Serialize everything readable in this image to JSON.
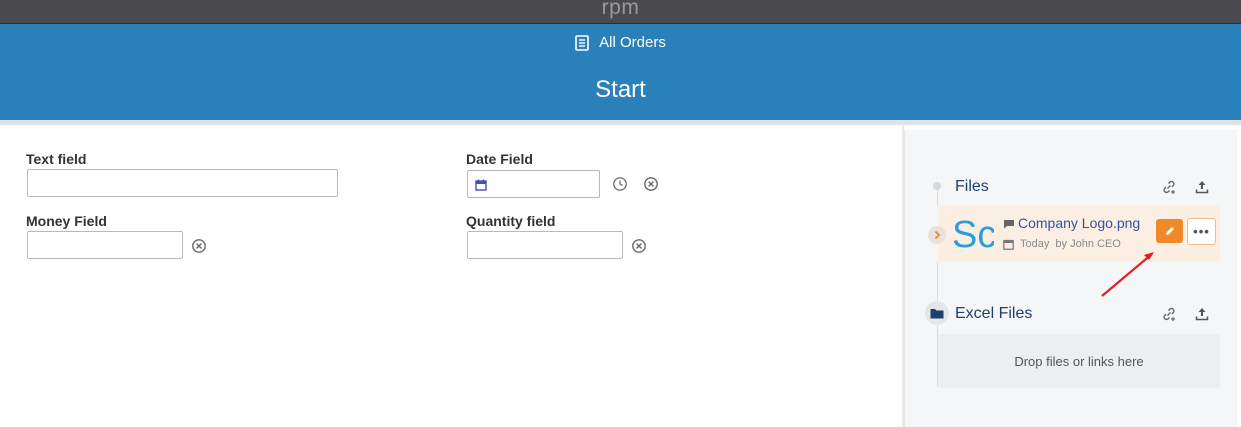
{
  "topbar": {
    "app_name": "rpm"
  },
  "header": {
    "breadcrumb": "All Orders",
    "title": "Start"
  },
  "form": {
    "text_field_label": "Text field",
    "text_field_value": "",
    "date_field_label": "Date Field",
    "date_field_value": "",
    "money_field_label": "Money Field",
    "money_field_value": "",
    "quantity_field_label": "Quantity field",
    "quantity_field_value": ""
  },
  "files": {
    "title": "Files",
    "items": [
      {
        "name": "Company Logo.png",
        "date": "Today",
        "author": "by John CEO",
        "thumb_text": "Sc"
      }
    ]
  },
  "excel_files": {
    "title": "Excel Files",
    "drop_text": "Drop files or links here"
  },
  "colors": {
    "topbar": "#4a4a4e",
    "header": "#2a80b9",
    "accent_orange": "#f08a28",
    "arrow_red": "#e0201e"
  }
}
